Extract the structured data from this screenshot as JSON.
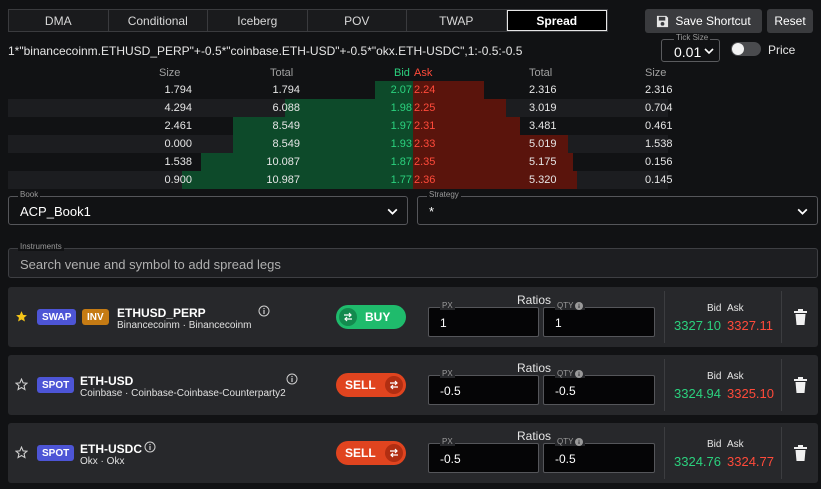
{
  "tabs": [
    {
      "label": "DMA",
      "active": false
    },
    {
      "label": "Conditional",
      "active": false
    },
    {
      "label": "Iceberg",
      "active": false
    },
    {
      "label": "POV",
      "active": false
    },
    {
      "label": "TWAP",
      "active": false
    },
    {
      "label": "Spread",
      "active": true
    }
  ],
  "toolbar": {
    "save_shortcut": "Save Shortcut",
    "reset": "Reset"
  },
  "formula": "1*\"binancecoinm.ETHUSD_PERP\"+-0.5*\"coinbase.ETH-USD\"+-0.5*\"okx.ETH-USDC\",1:-0.5:-0.5",
  "tick_size": {
    "label": "Tick Size",
    "value": "0.01"
  },
  "price_toggle": {
    "label": "Price",
    "on": false
  },
  "orderbook": {
    "headers": {
      "size_left": "Size",
      "total_left": "Total",
      "bid": "Bid",
      "ask": "Ask",
      "total_right": "Total",
      "size_right": "Size"
    },
    "rows": [
      {
        "bid_size": "1.794",
        "bid_total": "1.794",
        "bid": "2.07",
        "ask": "2.24",
        "ask_total": "2.316",
        "ask_size": "2.316",
        "bid_depth": 0.163,
        "ask_depth": 0.435
      },
      {
        "bid_size": "4.294",
        "bid_total": "6.088",
        "bid": "1.98",
        "ask": "2.25",
        "ask_total": "3.019",
        "ask_size": "0.704",
        "bid_depth": 0.554,
        "ask_depth": 0.567
      },
      {
        "bid_size": "2.461",
        "bid_total": "8.549",
        "bid": "1.97",
        "ask": "2.31",
        "ask_total": "3.481",
        "ask_size": "0.461",
        "bid_depth": 0.778,
        "ask_depth": 0.654
      },
      {
        "bid_size": "0.000",
        "bid_total": "8.549",
        "bid": "1.93",
        "ask": "2.33",
        "ask_total": "5.019",
        "ask_size": "1.538",
        "bid_depth": 0.778,
        "ask_depth": 0.943
      },
      {
        "bid_size": "1.538",
        "bid_total": "10.087",
        "bid": "1.87",
        "ask": "2.35",
        "ask_total": "5.175",
        "ask_size": "0.156",
        "bid_depth": 0.918,
        "ask_depth": 0.973
      },
      {
        "bid_size": "0.900",
        "bid_total": "10.987",
        "bid": "1.77",
        "ask": "2.36",
        "ask_total": "5.320",
        "ask_size": "0.145",
        "bid_depth": 1.0,
        "ask_depth": 1.0
      }
    ]
  },
  "book": {
    "label": "Book",
    "value": "ACP_Book1"
  },
  "strategy": {
    "label": "Strategy",
    "value": "*"
  },
  "instruments": {
    "label": "Instruments",
    "placeholder": "Search venue and symbol to add spread legs"
  },
  "legs": [
    {
      "starred": true,
      "badges": [
        "SWAP",
        "INV"
      ],
      "symbol": "ETHUSD_PERP",
      "venue": "Binancecoinm · Binancecoinm",
      "side": "BUY",
      "ratios_label": "Ratios",
      "px_label": "PX",
      "qty_label": "QTY",
      "px": "1",
      "qty": "1",
      "bid_label": "Bid",
      "ask_label": "Ask",
      "bid": "3327.10",
      "ask": "3327.11"
    },
    {
      "starred": false,
      "badges": [
        "SPOT"
      ],
      "symbol": "ETH-USD",
      "venue": "Coinbase · Coinbase-Coinbase-Counterparty2",
      "side": "SELL",
      "ratios_label": "Ratios",
      "px_label": "PX",
      "qty_label": "QTY",
      "px": "-0.5",
      "qty": "-0.5",
      "bid_label": "Bid",
      "ask_label": "Ask",
      "bid": "3324.94",
      "ask": "3325.10"
    },
    {
      "starred": false,
      "badges": [
        "SPOT"
      ],
      "symbol": "ETH-USDC",
      "venue": "Okx · Okx",
      "side": "SELL",
      "ratios_label": "Ratios",
      "px_label": "PX",
      "qty_label": "QTY",
      "px": "-0.5",
      "qty": "-0.5",
      "bid_label": "Bid",
      "ask_label": "Ask",
      "bid": "3324.76",
      "ask": "3324.77"
    }
  ],
  "colors": {
    "bid": "#2bd17e",
    "ask": "#ff4a3a",
    "buy": "#1fbb6c",
    "sell": "#e0441f",
    "badge_blue": "#4d55d6",
    "badge_orange": "#c57b14",
    "star": "#f5c518"
  }
}
